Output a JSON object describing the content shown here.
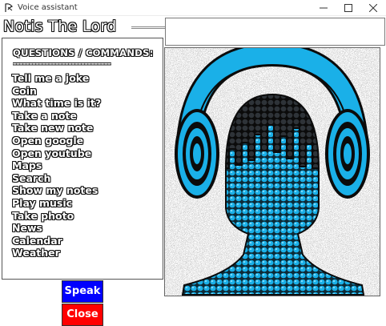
{
  "window": {
    "title": "Voice assistant",
    "icon": "feather-icon",
    "controls": [
      "minimize-icon",
      "maximize-icon",
      "close-icon"
    ]
  },
  "app": {
    "heading": "Notis The Lord"
  },
  "commands": {
    "title": "QUESTIONS / COMMANDS:",
    "separator": "------------------------------",
    "items": [
      "Tell me a joke",
      "Coin",
      "What time is it?",
      "Take a note",
      "Take new note",
      "Open google",
      "Open youtube",
      "Maps",
      "Search",
      "Show my notes",
      "Play music",
      "Take photo",
      "News",
      "Calendar",
      "Weather"
    ]
  },
  "image": {
    "subject": "headphones-head-icon",
    "colors": {
      "accent": "#1ab0e8",
      "dark": "#1a1a1a",
      "noise_bg": "#c8c8c8"
    }
  },
  "buttons": {
    "speak_label": "Speak",
    "speak_color": "#0000ff",
    "close_label": "Close",
    "close_color": "#ff0000"
  }
}
